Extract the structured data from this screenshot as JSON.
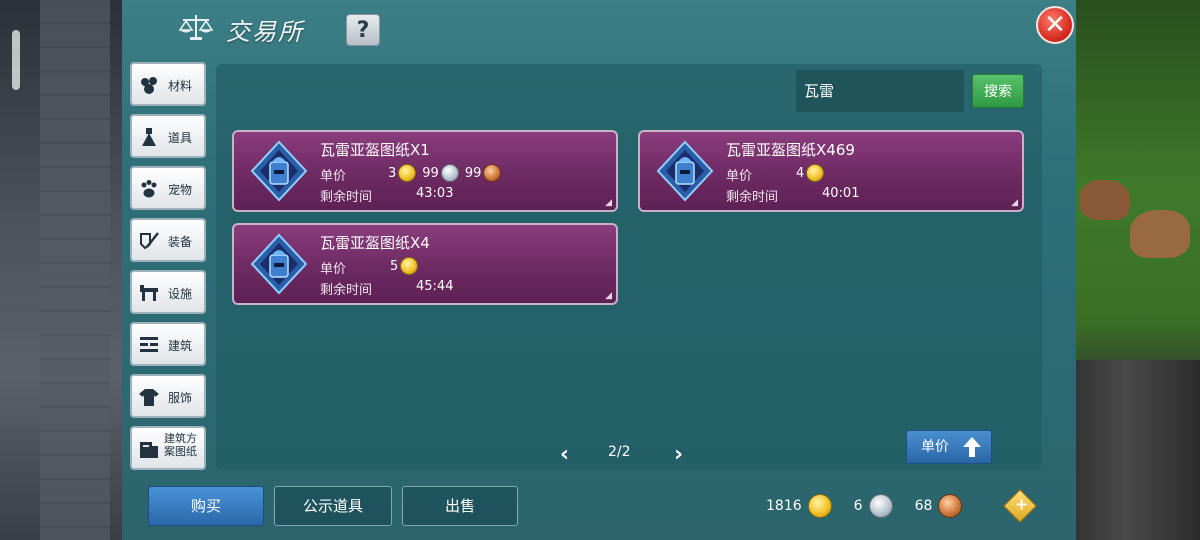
{
  "window": {
    "title": "交易所",
    "help_label": "?",
    "close_label": "✕"
  },
  "categories": [
    {
      "label": "材料",
      "icon": "materials-icon"
    },
    {
      "label": "道具",
      "icon": "item-icon"
    },
    {
      "label": "宠物",
      "icon": "paw-icon"
    },
    {
      "label": "装备",
      "icon": "equipment-icon"
    },
    {
      "label": "设施",
      "icon": "facility-icon"
    },
    {
      "label": "建筑",
      "icon": "building-icon"
    },
    {
      "label": "服饰",
      "icon": "clothing-icon"
    },
    {
      "label": "建筑方案图纸",
      "icon": "blueprint-icon"
    }
  ],
  "search": {
    "value": "瓦雷",
    "button_label": "搜索"
  },
  "listings": [
    {
      "name": "瓦雷亚盔图纸X1",
      "price_label": "单价",
      "gold": "3",
      "silver": "99",
      "copper": "99",
      "time_label": "剩余时间",
      "time": "43:03"
    },
    {
      "name": "瓦雷亚盔图纸X469",
      "price_label": "单价",
      "gold": "4",
      "time_label": "剩余时间",
      "time": "40:01"
    },
    {
      "name": "瓦雷亚盔图纸X4",
      "price_label": "单价",
      "gold": "5",
      "time_label": "剩余时间",
      "time": "45:44"
    }
  ],
  "pagination": {
    "prev": "‹",
    "next": "›",
    "text": "2/2"
  },
  "sort": {
    "label": "单价"
  },
  "actions": {
    "buy": "购买",
    "public_items": "公示道具",
    "sell": "出售"
  },
  "wallet": {
    "gold": "1816",
    "silver": "6",
    "copper": "68"
  },
  "colors": {
    "panel": "#2f7079",
    "card": "#6e2a63",
    "search_button": "#2f9a44",
    "primary_button": "#2a68ab",
    "close_button": "#d52a20"
  }
}
